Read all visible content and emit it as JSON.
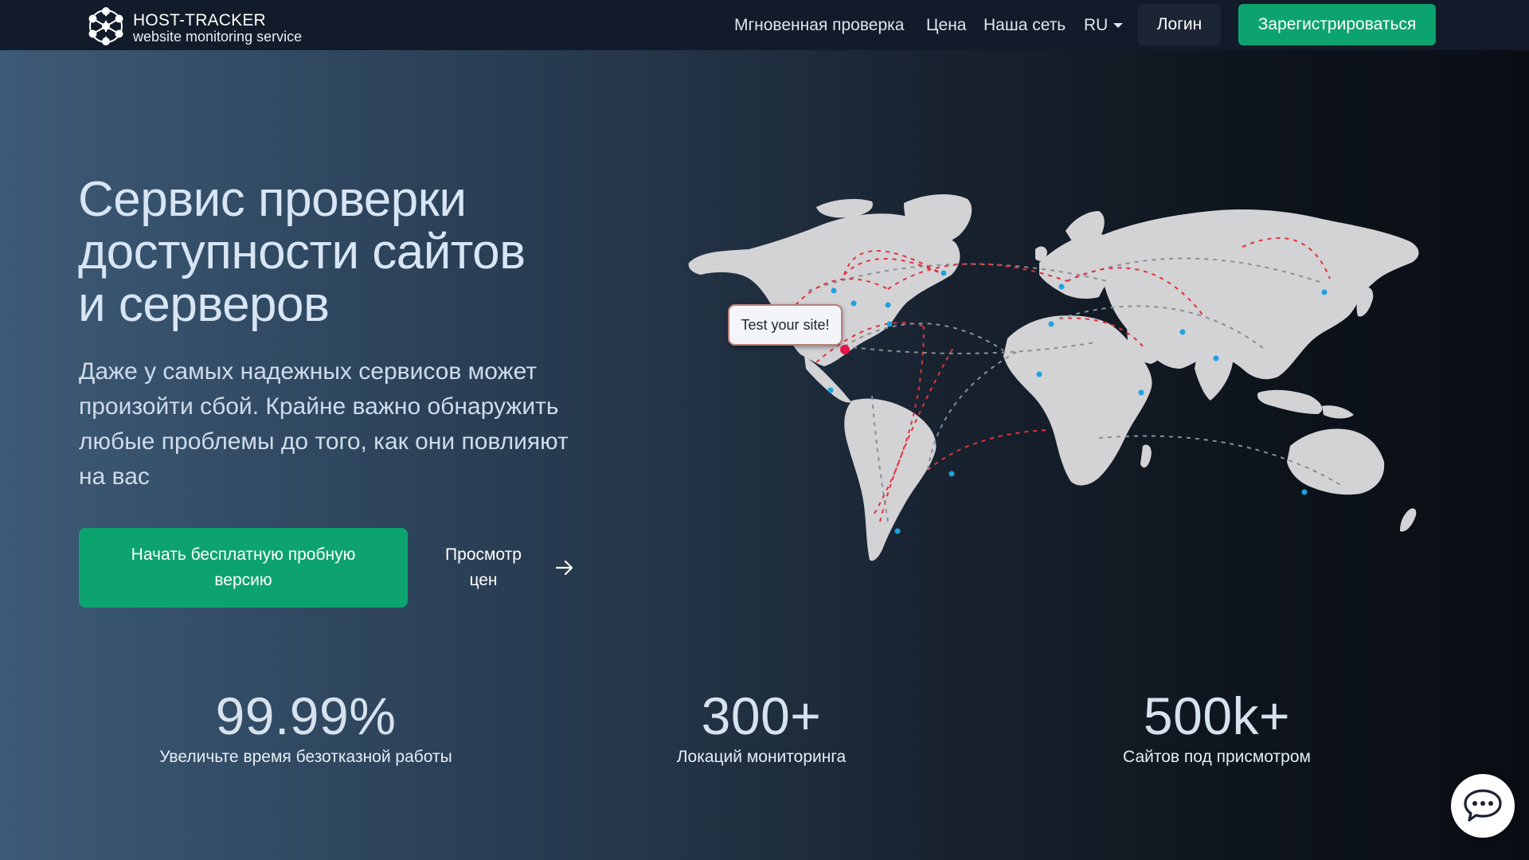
{
  "header": {
    "logo_title": "HOST-TRACKER",
    "logo_subtitle": "website monitoring service",
    "nav": [
      {
        "label": "Мгновенная проверка"
      },
      {
        "label": "Цена"
      },
      {
        "label": "Наша сеть"
      }
    ],
    "language": "RU",
    "login_label": "Логин",
    "register_label": "Зарегистрироваться"
  },
  "hero": {
    "title_line1": "Сервис проверки",
    "title_line2": "доступности сайтов",
    "title_line3": "и серверов",
    "description": "Даже у самых надежных сервисов может произойти сбой. Крайне важно обнаружить любые проблемы до того, как они повлияют на вас",
    "trial_button": "Начать бесплатную пробную версию",
    "prices_link": "Просмотр цен"
  },
  "map": {
    "tooltip": "Test your site!",
    "colors": {
      "land": "#d3d3d5",
      "route_active": "#e2323c",
      "route_inactive": "#8a8f96",
      "node": "#1fa2e0",
      "origin": "#e5144a"
    }
  },
  "stats": [
    {
      "value": "99.99%",
      "label": "Увеличьте время безотказной работы"
    },
    {
      "value": "300+",
      "label": "Локаций мониторинга"
    },
    {
      "value": "500k+",
      "label": "Сайтов под присмотром"
    }
  ],
  "colors": {
    "accent_green": "#0da36e",
    "header_bg": "#111b29"
  },
  "icons": {
    "logo": "hexagon-network-icon",
    "lang_dropdown": "caret-down-icon",
    "prices_arrow": "arrow-right-icon",
    "chat": "chat-bubble-icon"
  }
}
